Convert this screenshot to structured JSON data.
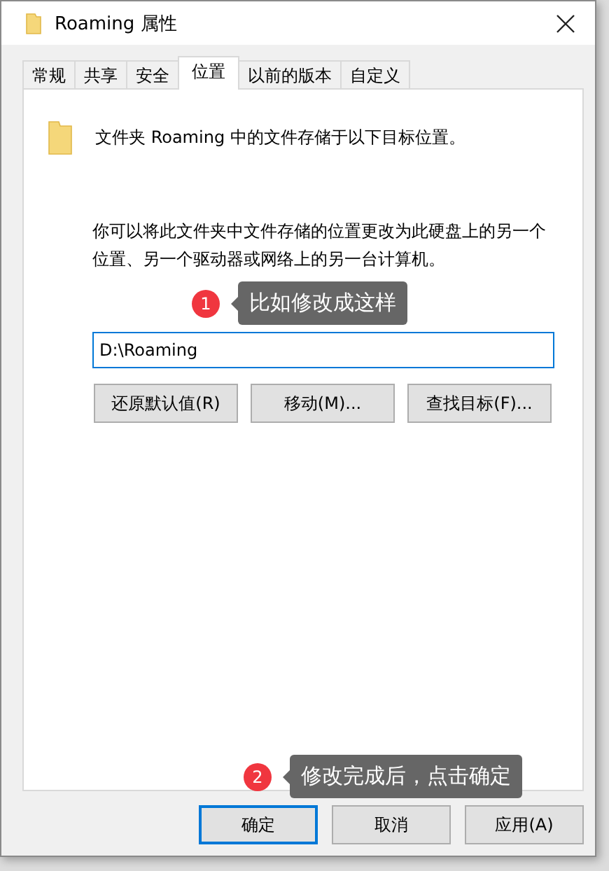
{
  "window": {
    "title": "Roaming 属性"
  },
  "tabs": [
    {
      "label": "常规",
      "selected": false
    },
    {
      "label": "共享",
      "selected": false
    },
    {
      "label": "安全",
      "selected": false
    },
    {
      "label": "位置",
      "selected": true
    },
    {
      "label": "以前的版本",
      "selected": false
    },
    {
      "label": "自定义",
      "selected": false
    }
  ],
  "location": {
    "heading": "文件夹 Roaming 中的文件存储于以下目标位置。",
    "description": "你可以将此文件夹中文件存储的位置更改为此硬盘上的另一个位置、另一个驱动器或网络上的另一台计算机。",
    "path": "D:\\Roaming",
    "buttons": [
      "还原默认值(R)",
      "移动(M)...",
      "查找目标(F)..."
    ]
  },
  "callouts": [
    {
      "number": "1",
      "text": "比如修改成这样"
    },
    {
      "number": "2",
      "text": "修改完成后，点击确定"
    }
  ],
  "dialog_buttons": [
    {
      "label": "确定",
      "selected": true
    },
    {
      "label": "取消",
      "selected": false
    },
    {
      "label": "应用(A)",
      "selected": false
    }
  ]
}
